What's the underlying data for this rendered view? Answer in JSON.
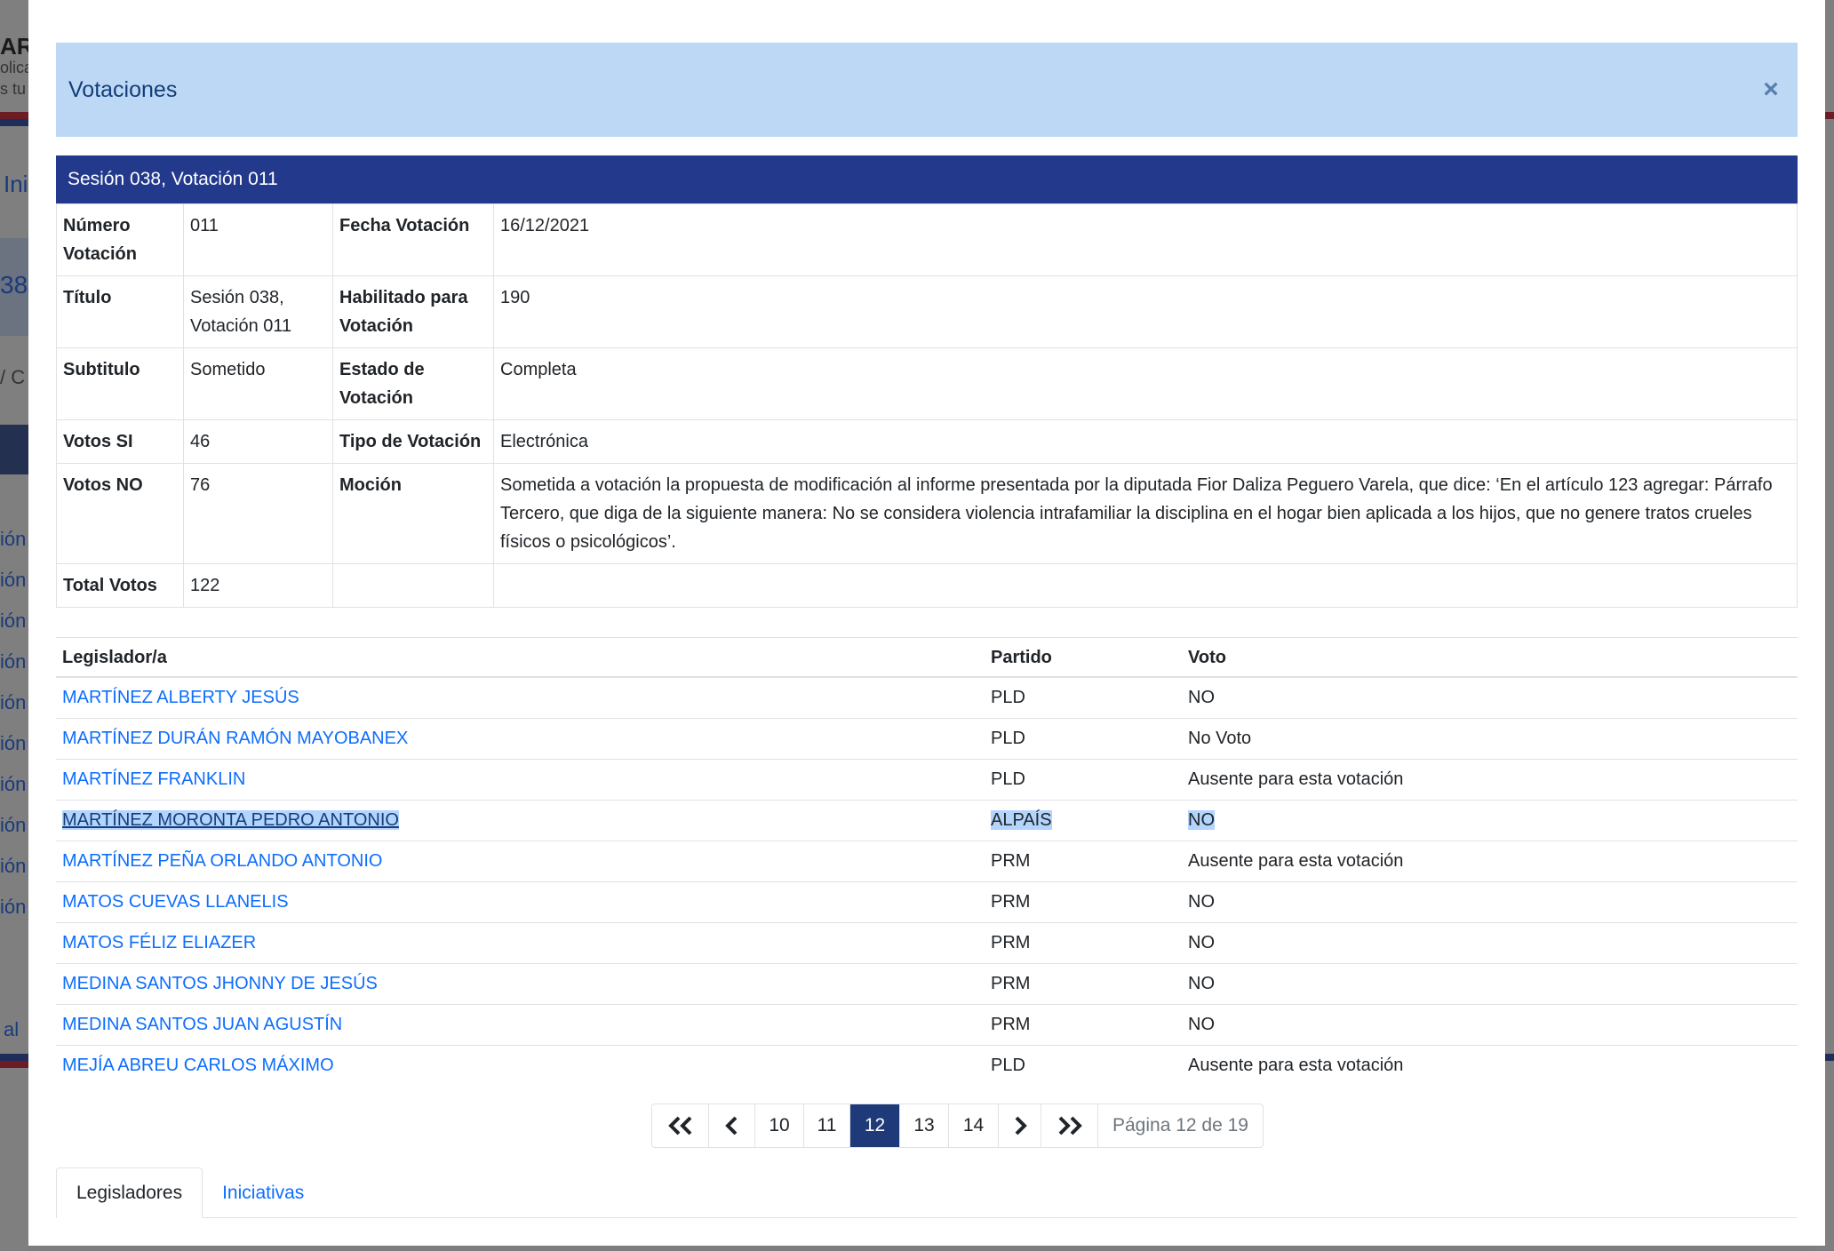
{
  "background": {
    "logo_text": "AR",
    "logo_sub1": "olica",
    "logo_sub2": "s tu",
    "nav_partial": "Ini",
    "number_partial": "38",
    "crumb_partial": "/  C",
    "side_links": [
      "ión",
      "ión",
      "ión",
      "ión",
      "ión",
      "ión",
      "ión",
      "ión",
      "ión",
      "ión"
    ],
    "footer_partial": "al"
  },
  "modal": {
    "title": "Votaciones",
    "close_icon": "×"
  },
  "session": {
    "header": "Sesión 038, Votación 011",
    "rows": [
      {
        "k1": "Número Votación",
        "v1": "011",
        "k2": "Fecha Votación",
        "v2": "16/12/2021"
      },
      {
        "k1": "Título",
        "v1": "Sesión 038, Votación 011",
        "k2": "Habilitado para Votación",
        "v2": "190"
      },
      {
        "k1": "Subtitulo",
        "v1": "Sometido",
        "k2": "Estado de Votación",
        "v2": "Completa"
      },
      {
        "k1": "Votos SI",
        "v1": "46",
        "k2": "Tipo de Votación",
        "v2": "Electrónica"
      },
      {
        "k1": "Votos NO",
        "v1": "76",
        "k2": "Moción",
        "v2": "Sometida a votación la propuesta de modificación al informe presentada por la diputada Fior Daliza Peguero Varela, que dice: ‘En el artículo 123 agregar: Párrafo Tercero, que diga de la siguiente manera: No se considera violencia intrafamiliar la disciplina en el hogar bien aplicada a los hijos, que no genere tratos crueles físicos o psicológicos’."
      },
      {
        "k1": "Total Votos",
        "v1": "122",
        "k2": "",
        "v2": ""
      }
    ]
  },
  "votes": {
    "headers": {
      "legislator": "Legislador/a",
      "party": "Partido",
      "vote": "Voto"
    },
    "rows": [
      {
        "name": "MARTÍNEZ ALBERTY JESÚS",
        "party": "PLD",
        "vote": "NO"
      },
      {
        "name": "MARTÍNEZ DURÁN RAMÓN MAYOBANEX",
        "party": "PLD",
        "vote": "No Voto"
      },
      {
        "name": "MARTÍNEZ FRANKLIN",
        "party": "PLD",
        "vote": "Ausente para esta votación"
      },
      {
        "name": "MARTÍNEZ MORONTA PEDRO ANTONIO",
        "party": "ALPAÍS",
        "vote": "NO"
      },
      {
        "name": "MARTÍNEZ PEÑA ORLANDO ANTONIO",
        "party": "PRM",
        "vote": "Ausente para esta votación"
      },
      {
        "name": "MATOS CUEVAS LLANELIS",
        "party": "PRM",
        "vote": "NO"
      },
      {
        "name": "MATOS FÉLIZ ELIAZER",
        "party": "PRM",
        "vote": "NO"
      },
      {
        "name": "MEDINA SANTOS JHONNY DE JESÚS",
        "party": "PRM",
        "vote": "NO"
      },
      {
        "name": "MEDINA SANTOS JUAN AGUSTÍN",
        "party": "PRM",
        "vote": "NO"
      },
      {
        "name": "MEJÍA ABREU CARLOS MÁXIMO",
        "party": "PLD",
        "vote": "Ausente para esta votación"
      }
    ]
  },
  "pagination": {
    "first_icon": "double-chevron-left-icon",
    "prev_icon": "chevron-left-icon",
    "pages": [
      "10",
      "11",
      "12",
      "13",
      "14"
    ],
    "current": "12",
    "next_icon": "chevron-right-icon",
    "last_icon": "double-chevron-right-icon",
    "info": "Página 12 de 19"
  },
  "tabs": {
    "legislators": "Legisladores",
    "initiatives": "Iniciativas"
  },
  "colors": {
    "header_bg": "#bcd8f5",
    "section_bar": "#233a8c",
    "link": "#0d6efd",
    "active_page": "#1e3a78",
    "flag_red": "#c8102e",
    "flag_blue": "#233a8c"
  }
}
